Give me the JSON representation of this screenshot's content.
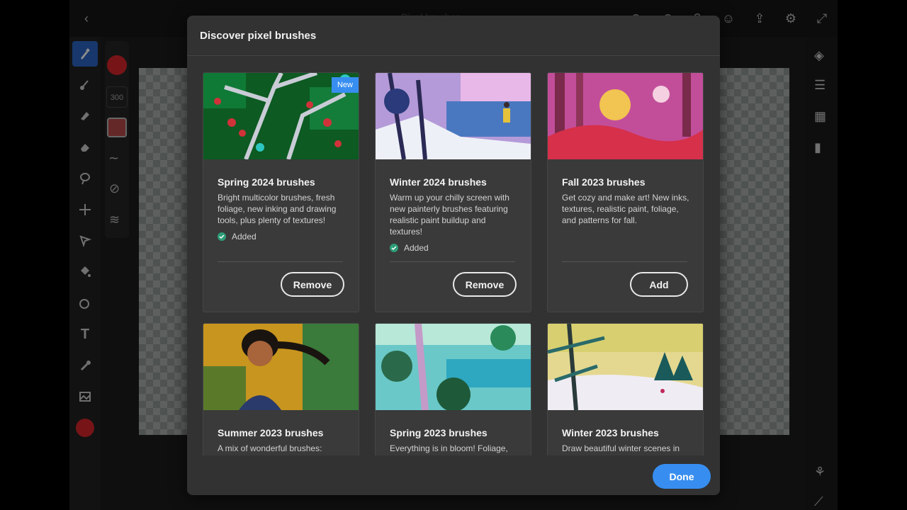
{
  "topbar": {
    "doc_title": "Pixel brushes",
    "back_icon": "back-icon",
    "right_icons": [
      "undo-icon",
      "redo-icon",
      "help-icon",
      "user-icon",
      "share-icon",
      "settings-icon",
      "fullscreen-icon"
    ]
  },
  "toolbar": {
    "brush_size": "300",
    "primary_color": "#d9262b",
    "tools": [
      "brush-icon",
      "smudge-icon",
      "fill-brush-icon",
      "eraser-icon",
      "lasso-icon",
      "move-icon",
      "select-icon",
      "paint-bucket-icon",
      "shape-icon",
      "text-icon",
      "eyedropper-icon",
      "image-icon",
      "color-icon"
    ]
  },
  "modal": {
    "title": "Discover pixel brushes",
    "done_label": "Done",
    "cards": [
      {
        "title": "Spring 2024 brushes",
        "badge": "New",
        "description": "Bright multicolor brushes, fresh foliage, new inking and drawing tools, plus plenty of textures!",
        "status": "Added",
        "action": "Remove"
      },
      {
        "title": "Winter 2024 brushes",
        "description": "Warm up your chilly screen with new painterly brushes featuring realistic paint buildup and textures!",
        "status": "Added",
        "action": "Remove"
      },
      {
        "title": "Fall 2023 brushes",
        "description": "Get cozy and make art! New inks, textures, realistic paint, foliage, and patterns for fall.",
        "action": "Add"
      },
      {
        "title": "Summer 2023 brushes",
        "description": "A mix of wonderful brushes:"
      },
      {
        "title": "Spring 2023 brushes",
        "description": "Everything is in bloom! Foliage,"
      },
      {
        "title": "Winter 2023 brushes",
        "description": "Draw beautiful winter scenes in"
      }
    ]
  },
  "colors": {
    "accent": "#378ef0",
    "success": "#2d9d78",
    "modal_bg": "#323232",
    "card_bg": "#3a3a3a"
  }
}
